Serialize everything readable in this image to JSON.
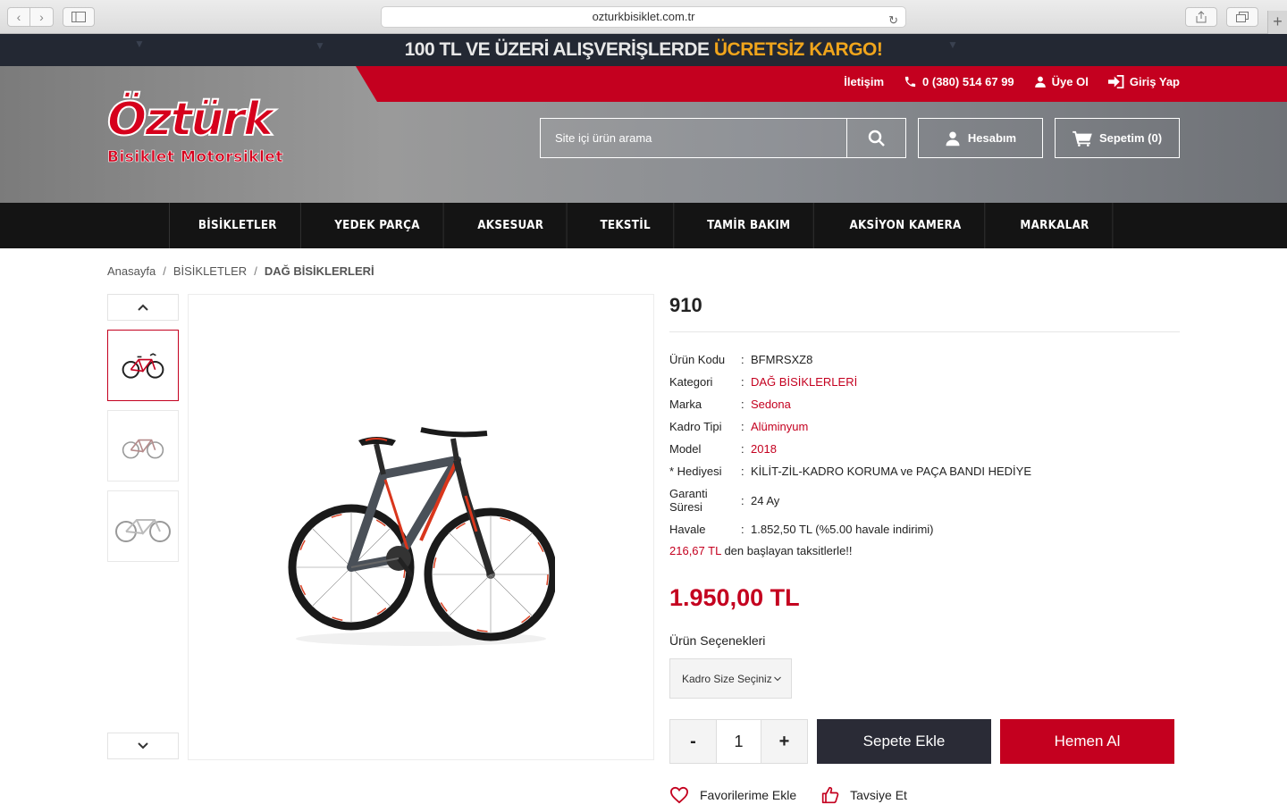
{
  "browser": {
    "url": "ozturkbisiklet.com.tr"
  },
  "promo": {
    "text_main": "100 TL VE ÜZERİ ALIŞVERİŞLERDE ",
    "text_highlight": "ÜCRETSİZ KARGO!"
  },
  "top_links": {
    "contact": "İletişim",
    "phone": "0 (380) 514 67 99",
    "register": "Üye Ol",
    "login": "Giriş Yap"
  },
  "logo": {
    "main": "Öztürk",
    "sub": "Bisiklet Motorsiklet"
  },
  "search": {
    "placeholder": "Site içi ürün arama"
  },
  "header_buttons": {
    "account": "Hesabım",
    "cart": "Sepetim (0)"
  },
  "nav": [
    "BİSİKLETLER",
    "YEDEK PARÇA",
    "AKSESUAR",
    "TEKSTİL",
    "TAMİR BAKIM",
    "AKSİYON KAMERA",
    "MARKALAR"
  ],
  "breadcrumb": {
    "home": "Anasayfa",
    "sep": "/",
    "category": "BİSİKLETLER",
    "current": "DAĞ BİSİKLERLERİ"
  },
  "product": {
    "name": "910",
    "specs": {
      "code_label": "Ürün Kodu",
      "code": "BFMRSXZ8",
      "category_label": "Kategori",
      "category": "DAĞ BİSİKLERLERİ",
      "brand_label": "Marka",
      "brand": "Sedona",
      "frame_label": "Kadro Tipi",
      "frame": "Alüminyum",
      "model_label": "Model",
      "model": "2018",
      "gift_label": "* Hediyesi",
      "gift": "KİLİT-ZİL-KADRO KORUMA ve PAÇA BANDI HEDİYE",
      "warranty_label": "Garanti Süresi",
      "warranty": "24 Ay",
      "transfer_label": "Havale",
      "transfer": "1.852,50 TL (%5.00 havale indirimi)"
    },
    "installment_amount": "216,67 TL",
    "installment_text": " den başlayan taksitlerle!!",
    "price": "1.950,00 TL",
    "options_label": "Ürün Seçenekleri",
    "size_select": "Kadro Size Seçiniz",
    "qty_minus": "-",
    "qty": "1",
    "qty_plus": "+",
    "add_to_cart": "Sepete Ekle",
    "buy_now": "Hemen Al",
    "favorite": "Favorilerime Ekle",
    "recommend": "Tavsiye Et"
  },
  "colors": {
    "brand_red": "#c4001f",
    "dark": "#2a2b36",
    "promo_bg": "#232833",
    "promo_highlight": "#f0a51c"
  }
}
